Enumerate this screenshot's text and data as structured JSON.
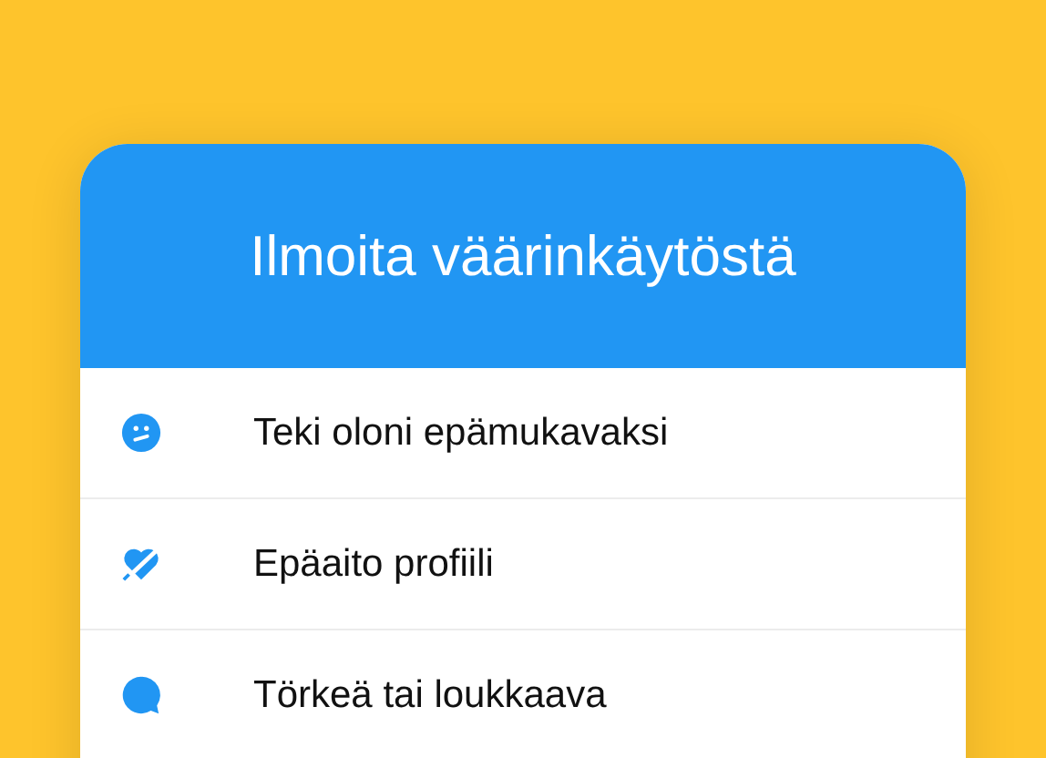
{
  "dialog": {
    "title": "Ilmoita väärinkäytöstä"
  },
  "options": [
    {
      "kind": "face",
      "label": "Teki oloni epämukavaksi"
    },
    {
      "kind": "heart",
      "label": "Epäaito profiili"
    },
    {
      "kind": "bubble",
      "label": "Törkeä tai loukkaava"
    }
  ]
}
